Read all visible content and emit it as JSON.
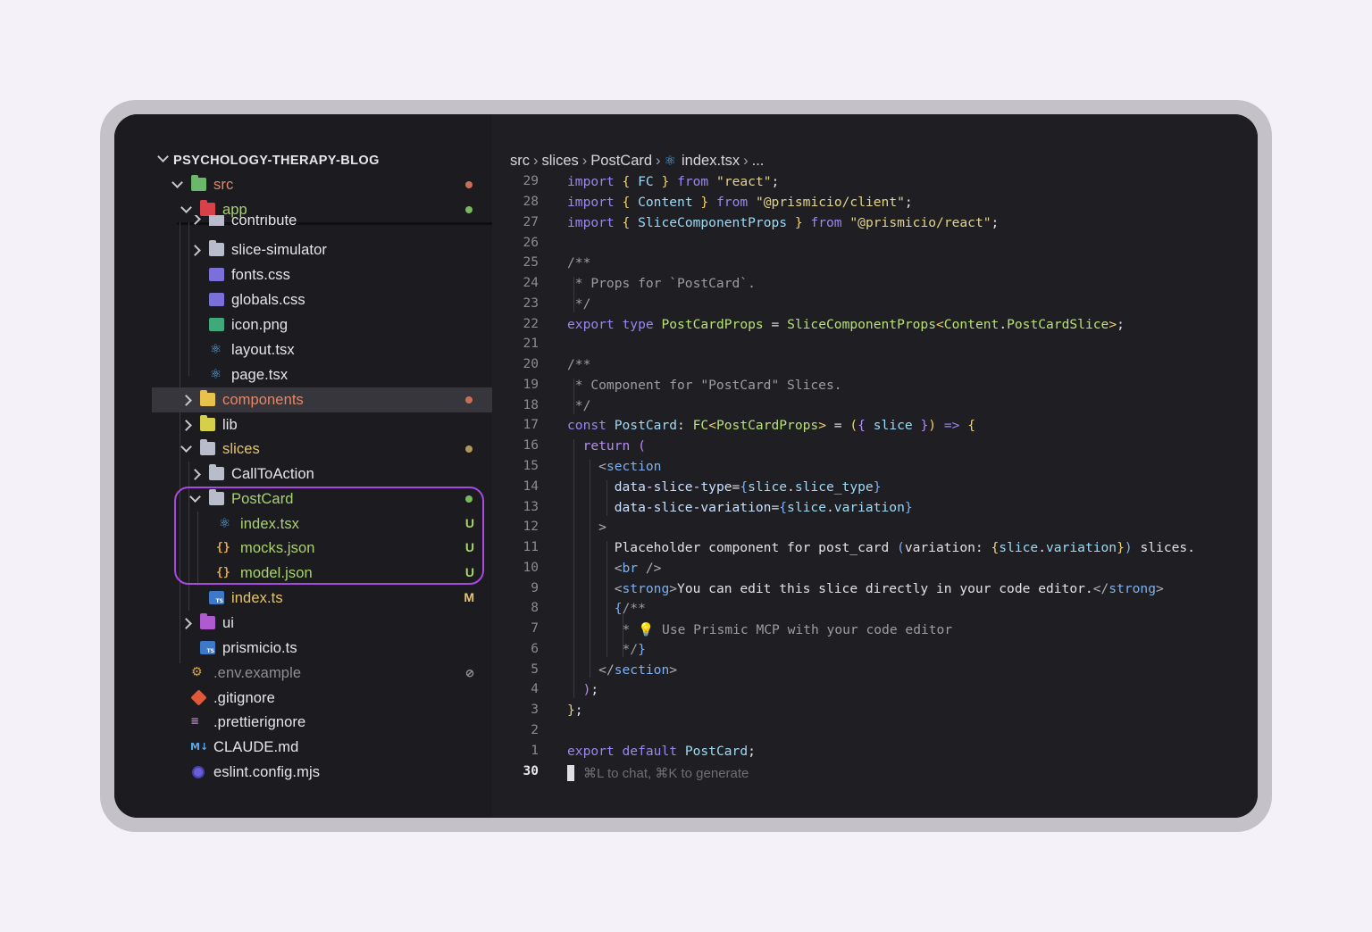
{
  "explorer": {
    "project_title": "PSYCHOLOGY-THERAPY-BLOG",
    "items": [
      {
        "label": "src",
        "badge": ""
      },
      {
        "label": "app",
        "badge": ""
      },
      {
        "label": "contribute",
        "badge": ""
      },
      {
        "label": "slice-simulator",
        "badge": ""
      },
      {
        "label": "fonts.css",
        "badge": ""
      },
      {
        "label": "globals.css",
        "badge": ""
      },
      {
        "label": "icon.png",
        "badge": ""
      },
      {
        "label": "layout.tsx",
        "badge": ""
      },
      {
        "label": "page.tsx",
        "badge": ""
      },
      {
        "label": "components",
        "badge": ""
      },
      {
        "label": "lib",
        "badge": ""
      },
      {
        "label": "slices",
        "badge": ""
      },
      {
        "label": "CallToAction",
        "badge": ""
      },
      {
        "label": "PostCard",
        "badge": ""
      },
      {
        "label": "index.tsx",
        "badge": "U"
      },
      {
        "label": "mocks.json",
        "badge": "U"
      },
      {
        "label": "model.json",
        "badge": "U"
      },
      {
        "label": "index.ts",
        "badge": "M"
      },
      {
        "label": "ui",
        "badge": ""
      },
      {
        "label": "prismicio.ts",
        "badge": ""
      },
      {
        "label": ".env.example",
        "badge": "⊘"
      },
      {
        "label": ".gitignore",
        "badge": ""
      },
      {
        "label": ".prettierignore",
        "badge": ""
      },
      {
        "label": "CLAUDE.md",
        "badge": ""
      },
      {
        "label": "eslint.config.mjs",
        "badge": ""
      }
    ]
  },
  "breadcrumb": {
    "parts": [
      "src",
      "slices",
      "PostCard",
      "index.tsx",
      "..."
    ]
  },
  "editor": {
    "line_numbers": [
      "29",
      "28",
      "27",
      "26",
      "25",
      "24",
      "23",
      "22",
      "21",
      "20",
      "19",
      "18",
      "17",
      "16",
      "15",
      "14",
      "13",
      "12",
      "11",
      "10",
      "9",
      "8",
      "7",
      "6",
      "5",
      "4",
      "3",
      "2",
      "1",
      "30"
    ],
    "hint": "⌘L to chat, ⌘K to generate"
  },
  "colors": {
    "highlight_border": "#a949e0",
    "untracked": "#a9d36f",
    "modified": "#e6c56a"
  }
}
